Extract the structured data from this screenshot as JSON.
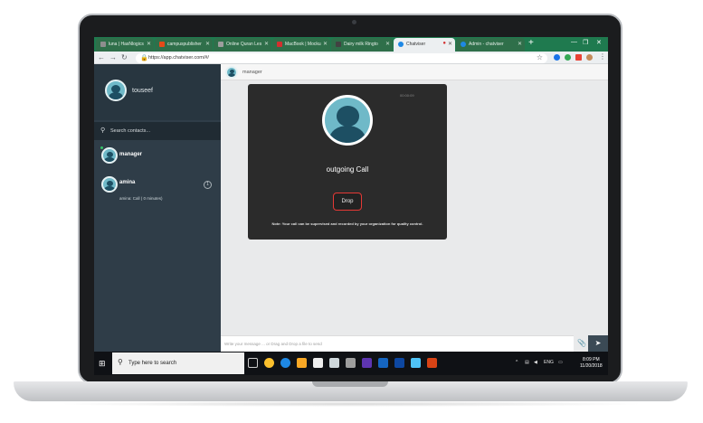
{
  "browser": {
    "tabs": [
      {
        "label": "luna | HasNlogics",
        "icon_color": "#8e8e8e"
      },
      {
        "label": "campuspublisher",
        "icon_color": "#e64a19"
      },
      {
        "label": "Online Quran Les",
        "icon_color": "#9e9e9e"
      },
      {
        "label": "MacBook | Mocku",
        "icon_color": "#d32f2f"
      },
      {
        "label": "Dairy milk Ringto",
        "icon_color": "#424242"
      },
      {
        "label": "Chatviser",
        "icon_color": "#1e88e5",
        "active": true
      },
      {
        "label": "Admin - chatviser",
        "icon_color": "#1e88e5"
      }
    ],
    "url": "https://app.chatviser.com/#/"
  },
  "sidebar": {
    "user_name": "touseef",
    "search_placeholder": "Search contacts...",
    "contacts": [
      {
        "name": "manager",
        "status": ""
      },
      {
        "name": "amina",
        "status": "amina: Call ( 0 minutes)",
        "badge": "1"
      }
    ]
  },
  "chat": {
    "header_name": "manager",
    "call": {
      "timer": "00:00:09",
      "status": "outgoing Call",
      "drop_label": "Drop",
      "note": "Note: Your call can be supervised and recorded by your organization for quality control."
    },
    "compose_placeholder": "Write your message ... or Drag and Drop a file to send"
  },
  "taskbar": {
    "search_placeholder": "Type here to search",
    "lang": "ENG",
    "time": "8:09 PM",
    "date": "11/20/2018"
  },
  "colors": {
    "tabbar": "#1f7a4f",
    "sidebar": "#2f3d48",
    "call_panel": "#2b2b2b",
    "drop_border": "#e53935"
  }
}
